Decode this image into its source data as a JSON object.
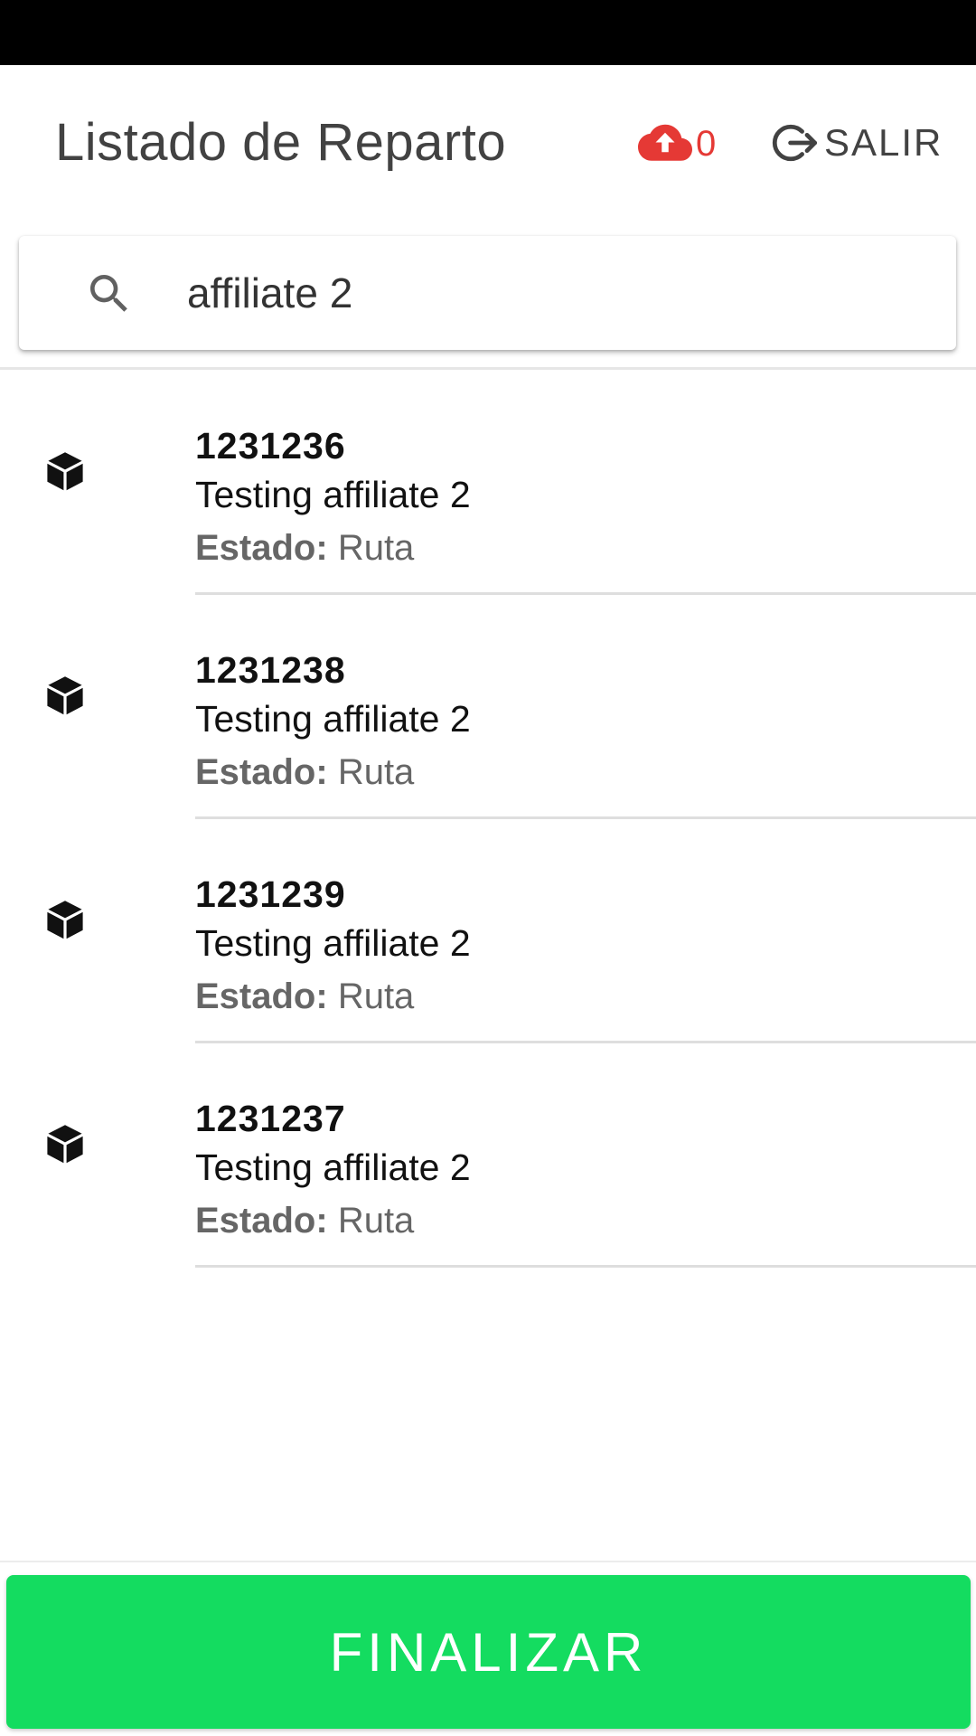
{
  "header": {
    "title": "Listado de Reparto",
    "sync": {
      "icon": "cloud-upload-icon",
      "count": "0",
      "color": "#e53935"
    },
    "logout": {
      "icon": "logout-icon",
      "label": "SALIR"
    }
  },
  "search": {
    "icon": "search-icon",
    "value": "affiliate 2",
    "placeholder": ""
  },
  "deliveries": [
    {
      "id": "1231236",
      "name": "Testing affiliate 2",
      "status_label": "Estado:",
      "status_value": "Ruta",
      "icon": "package-icon"
    },
    {
      "id": "1231238",
      "name": "Testing affiliate 2",
      "status_label": "Estado:",
      "status_value": "Ruta",
      "icon": "package-icon"
    },
    {
      "id": "1231239",
      "name": "Testing affiliate 2",
      "status_label": "Estado:",
      "status_value": "Ruta",
      "icon": "package-icon"
    },
    {
      "id": "1231237",
      "name": "Testing affiliate 2",
      "status_label": "Estado:",
      "status_value": "Ruta",
      "icon": "package-icon"
    }
  ],
  "footer": {
    "finalize_label": "FINALIZAR",
    "button_color": "#14dc60"
  }
}
